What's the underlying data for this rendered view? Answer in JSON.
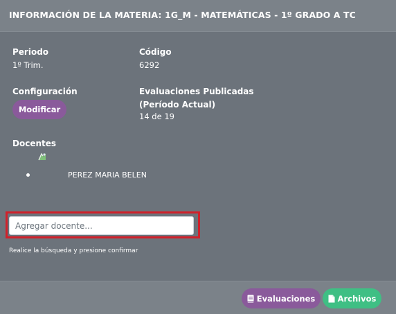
{
  "header": {
    "title": "INFORMACIÓN DE LA MATERIA: 1G_M - MATEMÁTICAS - 1º GRADO A TC"
  },
  "info": {
    "periodo_label": "Periodo",
    "periodo_value": "1º Trim.",
    "codigo_label": "Código",
    "codigo_value": "6292",
    "configuracion_label": "Configuración",
    "modificar_label": "Modificar",
    "evaluaciones_label_line1": "Evaluaciones Publicadas",
    "evaluaciones_label_line2": "(Período Actual)",
    "evaluaciones_value": "14 de 19"
  },
  "docentes": {
    "label": "Docentes",
    "items": [
      {
        "name": "PEREZ MARIA BELEN"
      }
    ]
  },
  "search": {
    "placeholder": "Agregar docente...",
    "hint": "Realice la búsqueda y presione confirmar"
  },
  "footer": {
    "evaluaciones_label": "Evaluaciones",
    "archivos_label": "Archivos"
  },
  "colors": {
    "background": "#6c737b",
    "header": "#7b8289",
    "purple_button": "#8a5a9b",
    "green_button": "#3fbf84",
    "highlight": "#d1202a"
  },
  "icons": {
    "avatar": "broken-image-icon",
    "evaluaciones": "book-icon",
    "archivos": "file-icon"
  }
}
